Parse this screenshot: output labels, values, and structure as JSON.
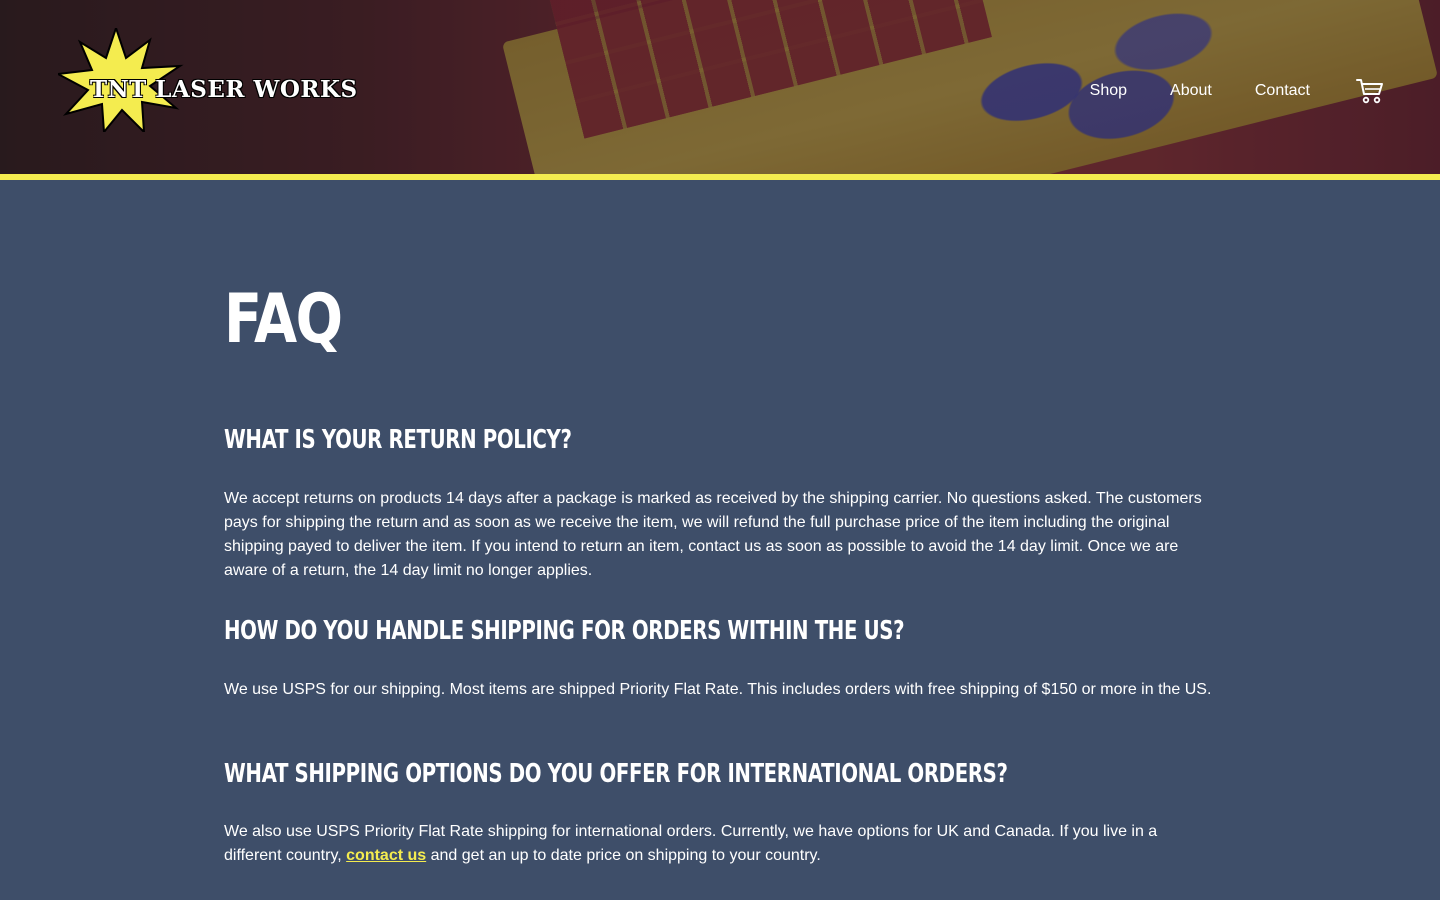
{
  "brand": {
    "name": "TNT LASER WORKS"
  },
  "nav": {
    "items": [
      "Shop",
      "About",
      "Contact"
    ],
    "cart_icon": "cart-icon"
  },
  "colors": {
    "background": "#3e4e69",
    "accent": "#f4ec4f",
    "text": "#ffffff"
  },
  "page": {
    "title": "FAQ"
  },
  "faq": [
    {
      "question": "WHAT IS YOUR RETURN POLICY?",
      "answer": "We accept returns on products 14 days after a package is marked as received by the shipping carrier. No questions asked. The customers pays for shipping the return and as soon as we receive the item, we will refund the full purchase price of the item including the original shipping payed to deliver the item. If you intend to return an item, contact us as soon as possible to avoid the 14 day limit. Once we are aware of a return, the 14 day limit no longer applies."
    },
    {
      "question": "HOW DO YOU HANDLE SHIPPING FOR ORDERS WITHIN THE US?",
      "answer": "We use USPS for our shipping. Most items are shipped Priority Flat Rate. This includes orders with free shipping of $150 or more in the US."
    },
    {
      "question": "WHAT SHIPPING OPTIONS DO YOU OFFER FOR INTERNATIONAL ORDERS?",
      "answer_before": "We also use USPS Priority Flat Rate shipping for international orders. Currently, we have options for UK and Canada. If you live in a different country,",
      "answer_link": "contact us",
      "answer_after": "and get an up to date price on shipping to your country."
    }
  ]
}
